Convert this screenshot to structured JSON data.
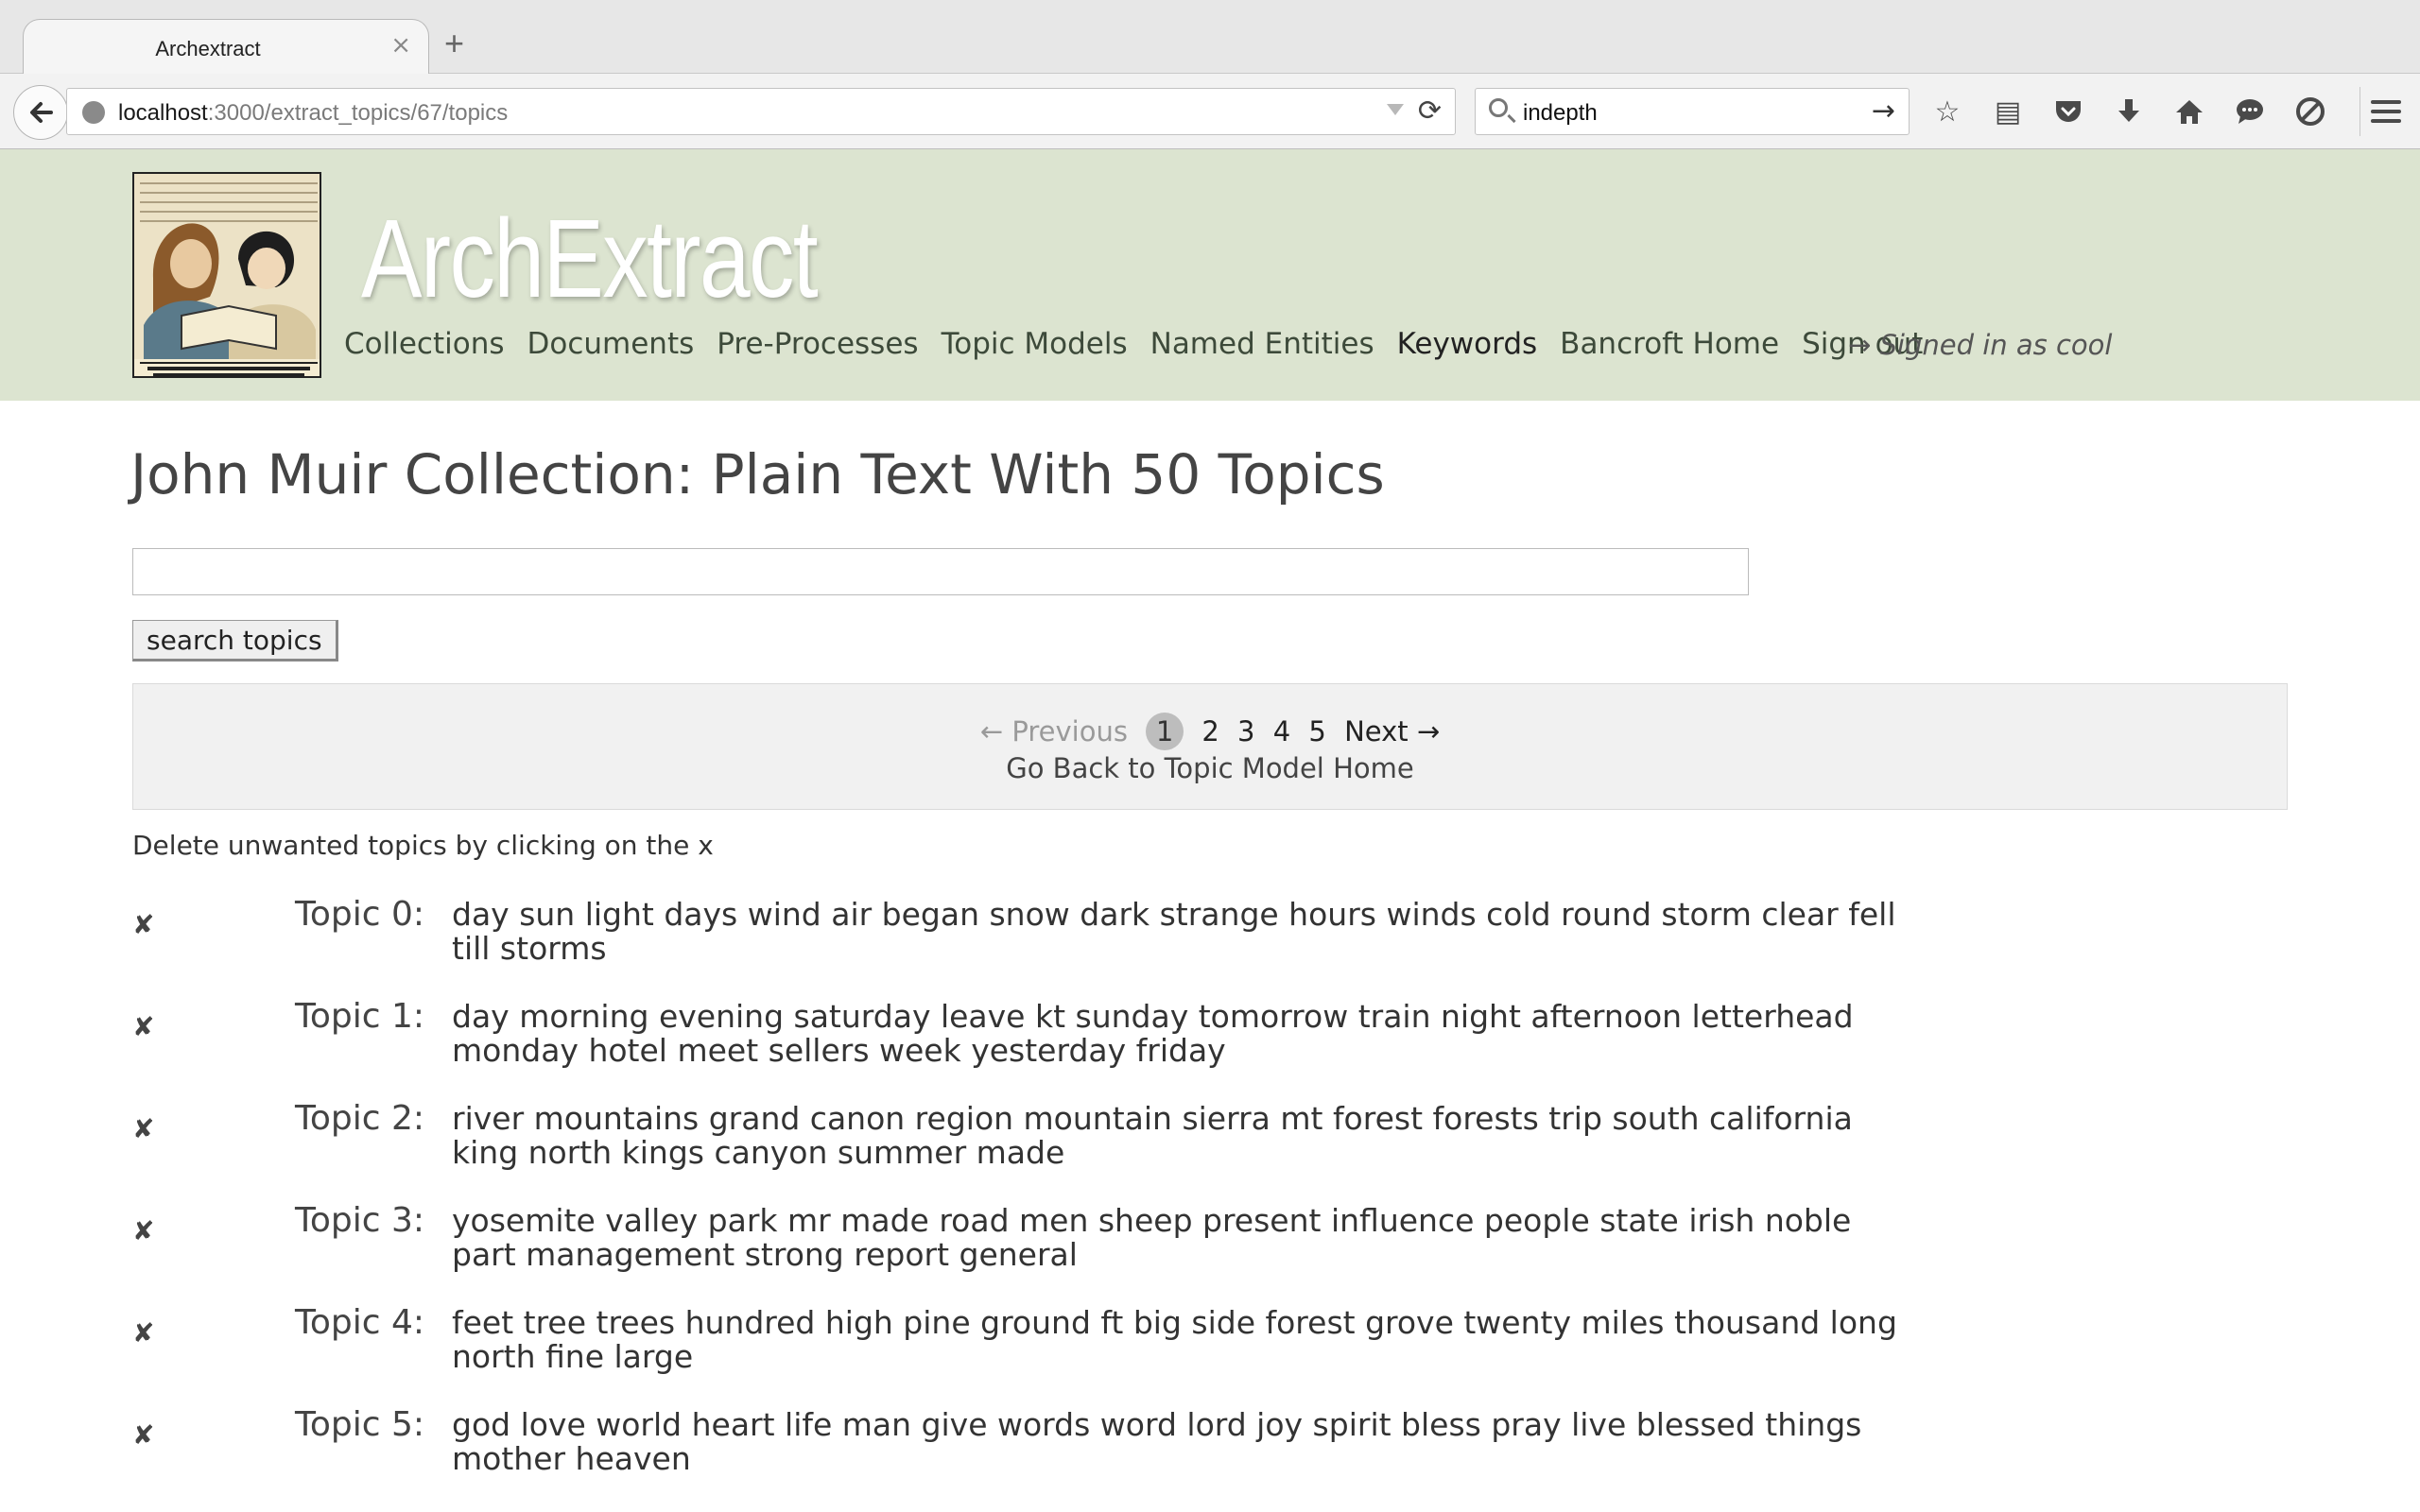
{
  "browser": {
    "tab_title": "Archextract",
    "tab_close": "×",
    "new_tab": "+",
    "url_host": "localhost",
    "url_path": ":3000/extract_topics/67/topics",
    "search_value": "indepth",
    "toolbar_icons": [
      "star-icon",
      "reading-list-icon",
      "pocket-icon",
      "download-icon",
      "home-icon",
      "chat-icon",
      "blocked-icon"
    ]
  },
  "header": {
    "brand": "ArchExtract",
    "nav": [
      "Collections",
      "Documents",
      "Pre-Processes",
      "Topic Models",
      "Named Entities",
      "Keywords",
      "Bancroft Home",
      "Sign out"
    ],
    "signed_in": "→ Signed in as cool"
  },
  "main": {
    "title": "John Muir Collection: Plain Text With 50 Topics",
    "search_button": "search topics",
    "pagination": {
      "previous": "← Previous",
      "current": "1",
      "pages": [
        "2",
        "3",
        "4",
        "5"
      ],
      "next": "Next →",
      "back_link": "Go Back to Topic Model Home"
    },
    "delete_note": "Delete unwanted topics by clicking on the x",
    "delete_glyph": "✘",
    "topics": [
      {
        "label": "Topic 0:",
        "words": "day sun light days wind air began snow dark strange hours winds cold round storm clear fell till storms"
      },
      {
        "label": "Topic 1:",
        "words": "day morning evening saturday leave kt sunday tomorrow train night afternoon letterhead monday hotel meet sellers week yesterday friday"
      },
      {
        "label": "Topic 2:",
        "words": "river mountains grand canon region mountain sierra mt forest forests trip south california king north kings canyon summer made"
      },
      {
        "label": "Topic 3:",
        "words": "yosemite valley park mr made road men sheep present influence people state irish noble part management strong report general"
      },
      {
        "label": "Topic 4:",
        "words": "feet tree trees hundred high pine ground ft big side forest grove twenty miles thousand long north fine large"
      },
      {
        "label": "Topic 5:",
        "words": "god love world heart life man give words word lord joy spirit bless pray live blessed things mother heaven"
      }
    ]
  }
}
